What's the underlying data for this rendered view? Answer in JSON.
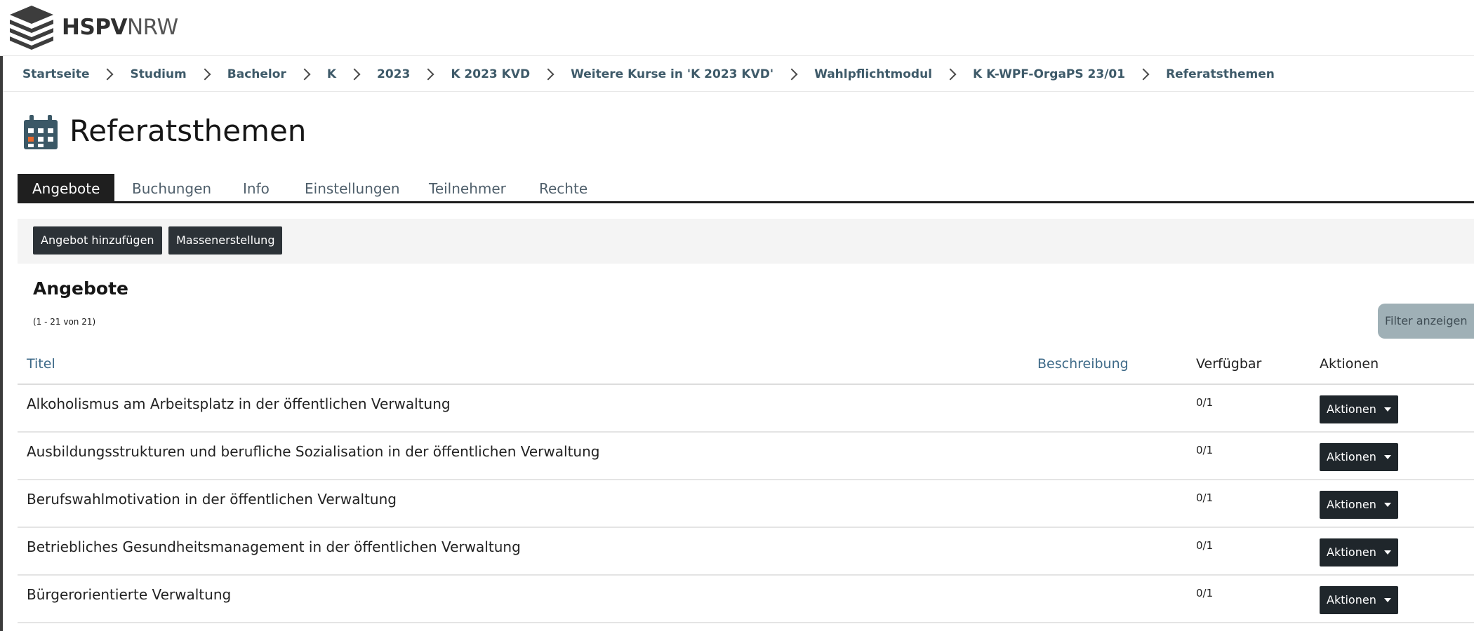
{
  "header": {
    "logo_bold": "HSPV",
    "logo_light": "NRW"
  },
  "breadcrumb": [
    "Startseite",
    "Studium",
    "Bachelor",
    "K",
    "2023",
    "K 2023 KVD",
    "Weitere Kurse in 'K 2023 KVD'",
    "Wahlpflichtmodul",
    "K K-WPF-OrgaPS 23/01",
    "Referatsthemen"
  ],
  "page": {
    "title": "Referatsthemen",
    "icon": "calendar-icon"
  },
  "tabs": [
    "Angebote",
    "Buchungen",
    "Info",
    "Einstellungen",
    "Teilnehmer",
    "Rechte"
  ],
  "toolbar": {
    "add_label": "Angebot hinzufügen",
    "bulk_label": "Massenerstellung"
  },
  "section": {
    "title": "Angebote",
    "count": "(1 - 21 von 21)",
    "filter_label": "Filter anzeigen"
  },
  "table": {
    "headers": {
      "title": "Titel",
      "description": "Beschreibung",
      "available": "Verfügbar",
      "actions": "Aktionen"
    },
    "rows": [
      {
        "title": "Alkoholismus am Arbeitsplatz in der öffentlichen Verwaltung",
        "available": "0/1",
        "action": "Aktionen"
      },
      {
        "title": "Ausbildungsstrukturen und berufliche Sozialisation in der öffentlichen Verwaltung",
        "available": "0/1",
        "action": "Aktionen"
      },
      {
        "title": "Berufswahlmotivation in der öffentlichen Verwaltung",
        "available": "0/1",
        "action": "Aktionen"
      },
      {
        "title": "Betriebliches Gesundheitsmanagement in der öffentlichen Verwaltung",
        "available": "0/1",
        "action": "Aktionen"
      },
      {
        "title": "Bürgerorientierte Verwaltung",
        "available": "0/1",
        "action": "Aktionen"
      }
    ]
  },
  "colors": {
    "dark_button": "#2c3237",
    "link": "#3e6a88",
    "filter_button": "#9fb0b6",
    "calendar_accent": "#e8692c"
  }
}
